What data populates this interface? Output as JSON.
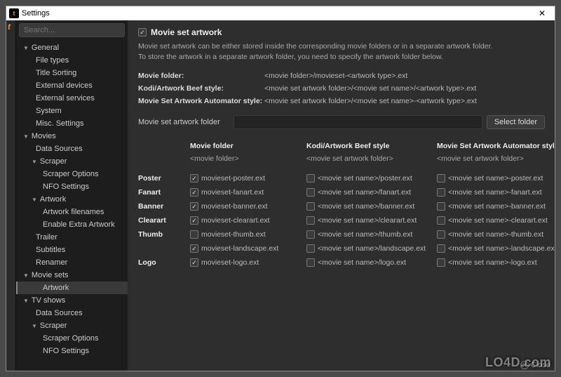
{
  "window": {
    "title": "Settings"
  },
  "search": {
    "placeholder": "Search..."
  },
  "sidebar": {
    "groups": [
      {
        "label": "General",
        "items": [
          "File types",
          "Title Sorting",
          "External devices",
          "External services",
          "System",
          "Misc. Settings"
        ]
      },
      {
        "label": "Movies",
        "items": [
          "Data Sources"
        ],
        "subgroups": [
          {
            "label": "Scraper",
            "items": [
              "Scraper Options",
              "NFO Settings"
            ]
          },
          {
            "label": "Artwork",
            "items": [
              "Artwork filenames",
              "Enable Extra Artwork"
            ]
          }
        ],
        "tail": [
          "Trailer",
          "Subtitles",
          "Renamer"
        ]
      },
      {
        "label": "Movie sets",
        "items": [
          "Artwork"
        ]
      },
      {
        "label": "TV shows",
        "items": [
          "Data Sources"
        ],
        "subgroups": [
          {
            "label": "Scraper",
            "items": [
              "Scraper Options",
              "NFO Settings"
            ]
          }
        ]
      }
    ]
  },
  "main": {
    "title": "Movie set artwork",
    "desc1": "Movie set artwork can be either stored inside the corresponding movie folders or in a separate artwork folder.",
    "desc2": "To store the artwork in a separate artwork folder, you need to specify the artwork folder below.",
    "paths": [
      {
        "label": "Movie folder:",
        "value": "<movie folder>/movieset-<artwork type>.ext"
      },
      {
        "label": "Kodi/Artwork Beef style:",
        "value": "<movie set artwork folder>/<movie set name>/<artwork type>.ext"
      },
      {
        "label": "Movie Set Artwork Automator style:",
        "value": "<movie set artwork folder>/<movie set name>-<artwork type>.ext"
      }
    ],
    "folderLabel": "Movie set artwork folder",
    "selectFolder": "Select folder",
    "cols": [
      {
        "head": "Movie folder",
        "sub": "<movie folder>"
      },
      {
        "head": "Kodi/Artwork Beef style",
        "sub": "<movie set artwork folder>"
      },
      {
        "head": "Movie Set Artwork Automator style",
        "sub": "<movie set artwork folder>"
      }
    ],
    "rows": [
      {
        "label": "Poster",
        "cells": [
          {
            "checked": true,
            "text": "movieset-poster.ext"
          },
          {
            "checked": false,
            "text": "<movie set name>/poster.ext"
          },
          {
            "checked": false,
            "text": "<movie set name>-poster.ext"
          }
        ]
      },
      {
        "label": "Fanart",
        "cells": [
          {
            "checked": true,
            "text": "movieset-fanart.ext"
          },
          {
            "checked": false,
            "text": "<movie set name>/fanart.ext"
          },
          {
            "checked": false,
            "text": "<movie set name>-fanart.ext"
          }
        ]
      },
      {
        "label": "Banner",
        "cells": [
          {
            "checked": true,
            "text": "movieset-banner.ext"
          },
          {
            "checked": false,
            "text": "<movie set name>/banner.ext"
          },
          {
            "checked": false,
            "text": "<movie set name>-banner.ext"
          }
        ]
      },
      {
        "label": "Clearart",
        "cells": [
          {
            "checked": true,
            "text": "movieset-clearart.ext"
          },
          {
            "checked": false,
            "text": "<movie set name>/clearart.ext"
          },
          {
            "checked": false,
            "text": "<movie set name>-clearart.ext"
          }
        ]
      },
      {
        "label": "Thumb",
        "cells": [
          {
            "checked": false,
            "text": "movieset-thumb.ext"
          },
          {
            "checked": false,
            "text": "<movie set name>/thumb.ext"
          },
          {
            "checked": false,
            "text": "<movie set name>-thumb.ext"
          }
        ],
        "extra": [
          {
            "checked": true,
            "text": "movieset-landscape.ext"
          },
          {
            "checked": false,
            "text": "<movie set name>/landscape.ext"
          },
          {
            "checked": false,
            "text": "<movie set name>-landscape.ext"
          }
        ]
      },
      {
        "label": "Logo",
        "cells": [
          {
            "checked": true,
            "text": "movieset-logo.ext"
          },
          {
            "checked": false,
            "text": "<movie set name>/logo.ext"
          },
          {
            "checked": false,
            "text": "<movie set name>-logo.ext"
          }
        ]
      }
    ]
  },
  "footer": {
    "close": "Close"
  },
  "watermark": "LO4D.com"
}
